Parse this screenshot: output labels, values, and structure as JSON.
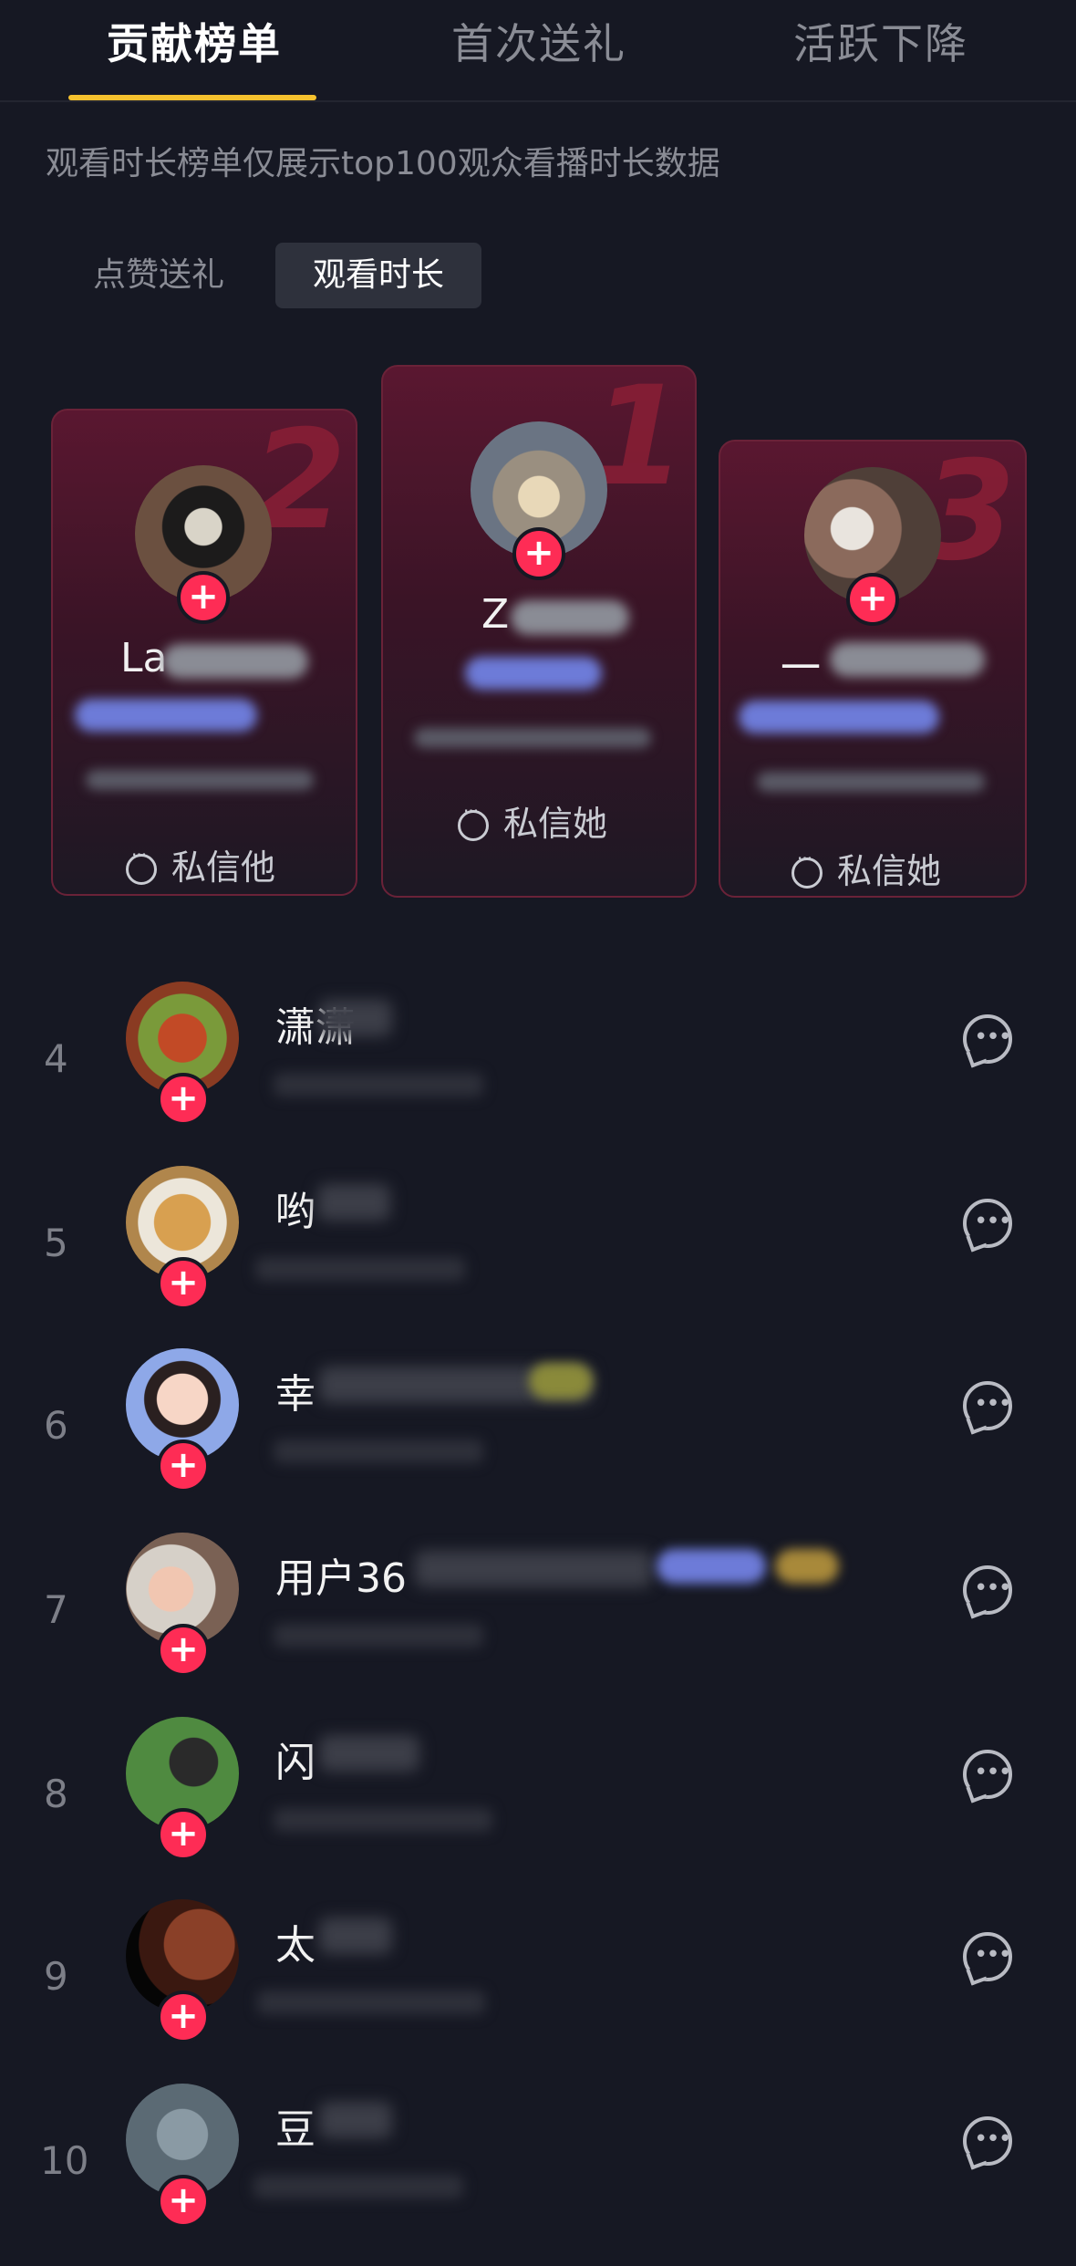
{
  "tabs": [
    "贡献榜单",
    "首次送礼",
    "活跃下降"
  ],
  "notice": "观看时长榜单仅展示top100观众看播时长数据",
  "segments": [
    "点赞送礼",
    "观看时长"
  ],
  "podium": [
    {
      "rank": "2",
      "name": "La",
      "dm": "私信他",
      "avatar_color": "#6b5040"
    },
    {
      "rank": "1",
      "name": "Z",
      "dm": "私信她",
      "avatar_color": "#8a8f98"
    },
    {
      "rank": "3",
      "name": "一",
      "dm": "私信她",
      "avatar_color": "#6c5a52"
    }
  ],
  "list": [
    {
      "num": "4",
      "name": "潇潇",
      "avatar_color": "#8a3b22"
    },
    {
      "num": "5",
      "name": "哟",
      "avatar_color": "#b0864c"
    },
    {
      "num": "6",
      "name": "幸",
      "avatar_color": "#f2c3a8"
    },
    {
      "num": "7",
      "name": "用户36",
      "avatar_color": "#7a6154"
    },
    {
      "num": "8",
      "name": "闪",
      "avatar_color": "#3d6a34"
    },
    {
      "num": "9",
      "name": "太",
      "avatar_color": "#5a2416"
    },
    {
      "num": "10",
      "name": "豆",
      "avatar_color": "#5b6a74"
    }
  ],
  "plus_symbol": "+",
  "accent": "#fe2c55",
  "tab_indicator": "#f5c12e"
}
